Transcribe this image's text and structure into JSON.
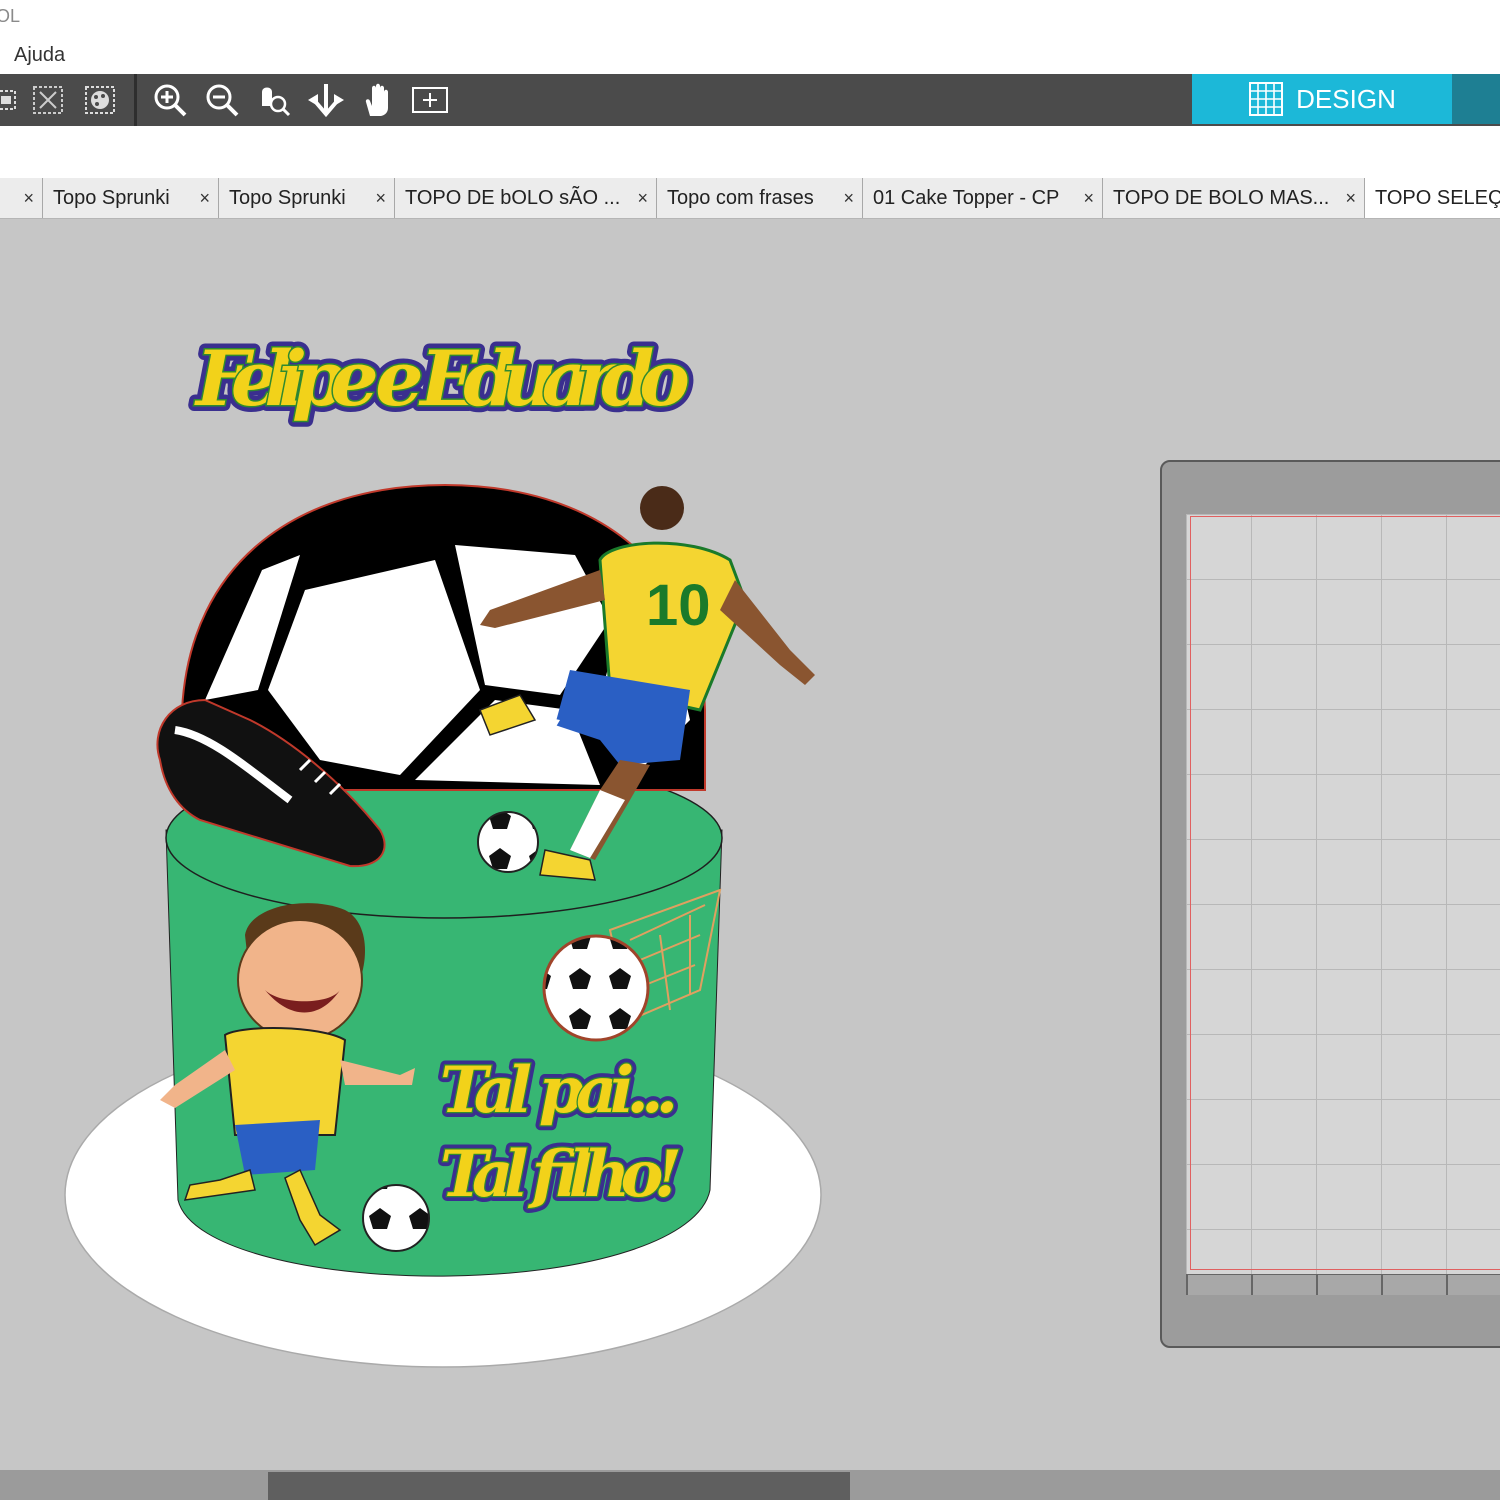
{
  "window": {
    "title_fragment": "OL"
  },
  "menu": {
    "items": [
      "Ajuda"
    ]
  },
  "toolbar": {
    "left_icons": [
      "group-icon",
      "delete-selection-icon",
      "color-picker-icon"
    ],
    "view_icons": [
      "zoom-in-icon",
      "zoom-out-icon",
      "zoom-selection-icon",
      "move-down-icon",
      "pan-hand-icon",
      "fit-page-icon"
    ],
    "design_label": "DESIGN"
  },
  "tabs": [
    {
      "label": "",
      "active": false
    },
    {
      "label": "Topo Sprunki",
      "active": false
    },
    {
      "label": "Topo Sprunki",
      "active": false
    },
    {
      "label": "TOPO DE bOLO sÃO ...",
      "active": false
    },
    {
      "label": "Topo com frases",
      "active": false
    },
    {
      "label": "01 Cake Topper - CP",
      "active": false
    },
    {
      "label": "TOPO DE BOLO MAS...",
      "active": false
    },
    {
      "label": "TOPO SELEÇÃ",
      "active": true
    }
  ],
  "tab_close_glyph": "×",
  "artwork": {
    "name_title": "Felipe e Eduardo",
    "phrase_line1": "Tal pai...",
    "phrase_line2": "Tal filho!",
    "jersey_number": "10"
  },
  "colors": {
    "toolbar_bg": "#4b4b4b",
    "design_accent": "#1cb8d8",
    "cake_green": "#37b673",
    "title_yellow": "#f2d21a",
    "title_green": "#2f8a2f",
    "title_outline": "#3a2f8f",
    "jersey_yellow": "#f4d531",
    "shorts_blue": "#2a5fc4"
  }
}
